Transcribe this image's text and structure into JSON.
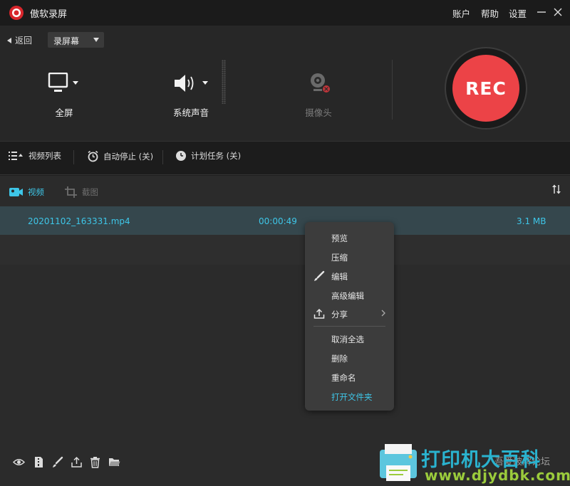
{
  "titlebar": {
    "title": "傲软录屏",
    "menu": [
      "账户",
      "帮助",
      "设置"
    ]
  },
  "toolbar": {
    "back_label": "返回",
    "mode_label": "录屏幕"
  },
  "sources": {
    "screen_label": "全屏",
    "audio_label": "系统声音",
    "camera_label": "摄像头"
  },
  "record": {
    "label": "REC",
    "color": "#ec4347"
  },
  "options": {
    "list_label": "视频列表",
    "auto_stop_label": "自动停止 (关)",
    "schedule_label": "计划任务 (关)"
  },
  "tabs": {
    "video_label": "视频",
    "screenshot_label": "截图"
  },
  "files": [
    {
      "name": "20201102_163331.mp4",
      "duration": "00:00:49",
      "size": "3.1 MB"
    }
  ],
  "context_menu": {
    "items": [
      "预览",
      "压缩",
      "编辑",
      "高级编辑",
      "分享",
      "取消全选",
      "删除",
      "重命名",
      "打开文件夹"
    ]
  },
  "watermark": {
    "brand": "打印机大百科",
    "url": "www.djydbk.com",
    "forum": "吾爱破解论坛"
  },
  "colors": {
    "accent": "#3ec6e8",
    "rec": "#ec4347",
    "selected_row": "#35474d"
  }
}
